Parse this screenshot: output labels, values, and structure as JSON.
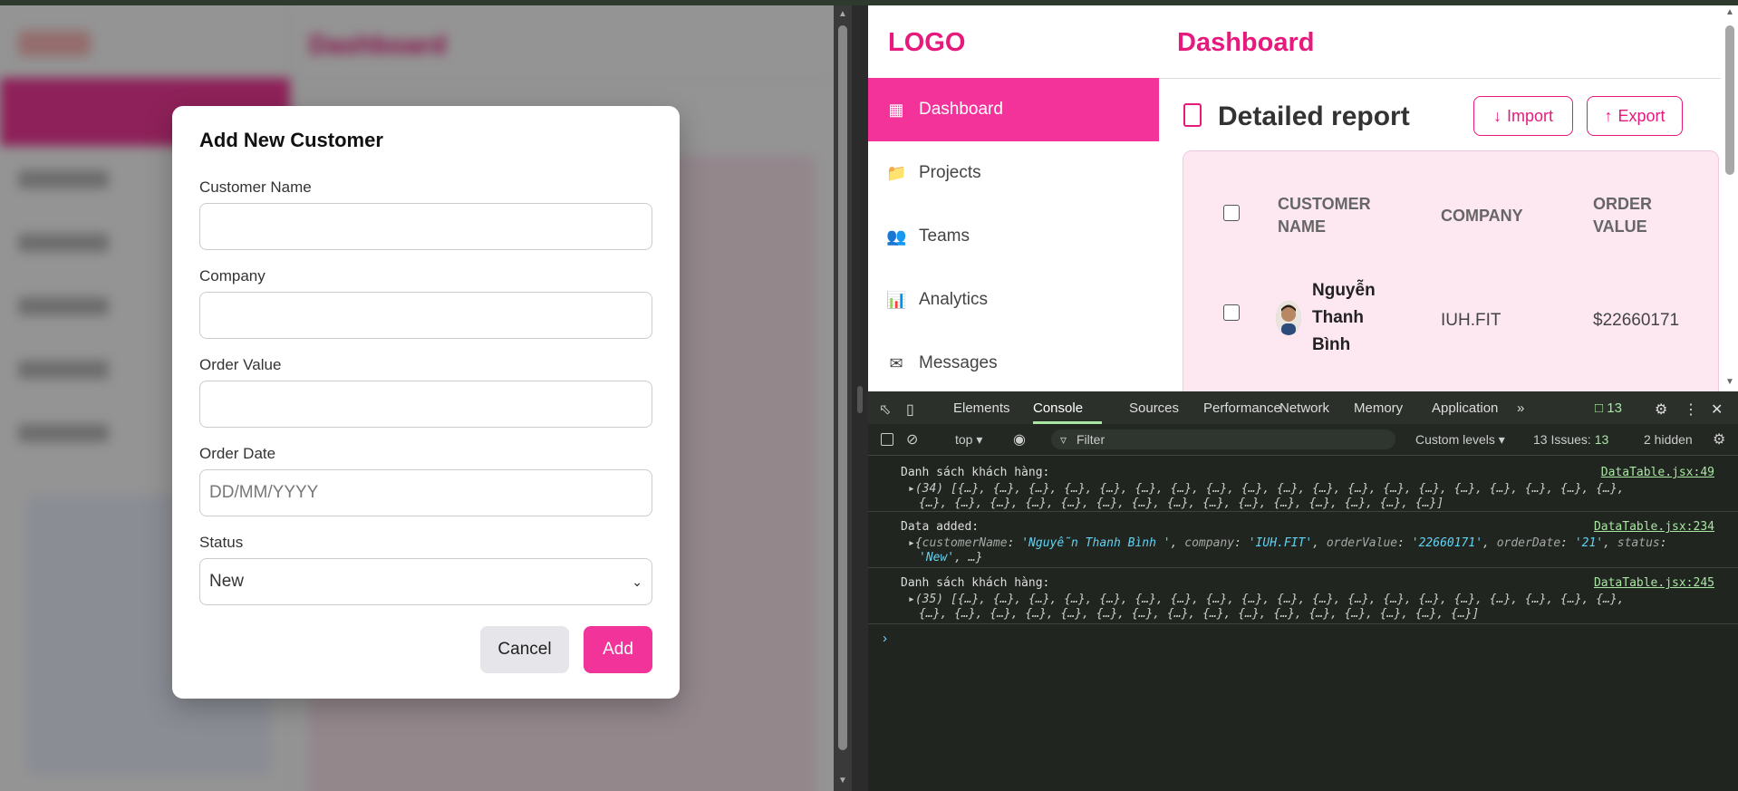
{
  "left": {
    "header_title": "Dashboard",
    "modal": {
      "title": "Add New Customer",
      "fields": [
        {
          "label": "Customer Name",
          "value": ""
        },
        {
          "label": "Company",
          "value": ""
        },
        {
          "label": "Order Value",
          "value": ""
        },
        {
          "label": "Order Date",
          "placeholder": "DD/MM/YYYY"
        },
        {
          "label": "Status",
          "value": "New"
        }
      ],
      "cancel_label": "Cancel",
      "add_label": "Add"
    }
  },
  "right": {
    "logo": "LOGO",
    "header_title": "Dashboard",
    "nav": [
      {
        "label": "Dashboard",
        "icon": "grid-icon"
      },
      {
        "label": "Projects",
        "icon": "folder-icon"
      },
      {
        "label": "Teams",
        "icon": "users-icon"
      },
      {
        "label": "Analytics",
        "icon": "chart-icon"
      },
      {
        "label": "Messages",
        "icon": "envelope-icon"
      }
    ],
    "report_title": "Detailed report",
    "import_label": "Import",
    "export_label": "Export",
    "table": {
      "headers": {
        "customer": "CUSTOMER NAME",
        "company": "COMPANY",
        "order": "ORDER VALUE"
      },
      "rows": [
        {
          "customer": "Nguyễn Thanh Bình",
          "company": "IUH.FIT",
          "order": "$22660171"
        }
      ]
    }
  },
  "devtools": {
    "tabs": [
      "Elements",
      "Console",
      "Sources",
      "Performance",
      "Network",
      "Memory",
      "Application"
    ],
    "active_tab": "Console",
    "issues_badge": "13",
    "context": "top",
    "filter_placeholder": "Filter",
    "levels": "Custom levels",
    "issues_text": "13 Issues:",
    "issues_count": "13",
    "hidden_text": "2 hidden",
    "logs": [
      {
        "msg": "Danh sách khách hàng:",
        "src": "DataTable.jsx:49",
        "line1": "(34) [{…}, {…}, {…}, {…}, {…}, {…}, {…}, {…}, {…}, {…}, {…}, {…}, {…}, {…}, {…}, {…}, {…}, {…}, {…},",
        "line2": "{…}, {…}, {…}, {…}, {…}, {…}, {…}, {…}, {…}, {…}, {…}, {…}, {…}, {…}, {…}]"
      },
      {
        "msg": "Data added:",
        "src": "DataTable.jsx:234"
      },
      {
        "msg": "Danh sách khách hàng:",
        "src": "DataTable.jsx:245",
        "line1": "(35) [{…}, {…}, {…}, {…}, {…}, {…}, {…}, {…}, {…}, {…}, {…}, {…}, {…}, {…}, {…}, {…}, {…}, {…}, {…},",
        "line2": "{…}, {…}, {…}, {…}, {…}, {…}, {…}, {…}, {…}, {…}, {…}, {…}, {…}, {…}, {…}, {…}]"
      }
    ],
    "added_obj": {
      "k1": "customerName",
      "v1": "'Nguyễn Thanh Bình '",
      "k2": "company",
      "v2": "'IUH.FIT'",
      "k3": "orderValue",
      "v3": "'22660171'",
      "k4": "orderDate",
      "v4": "'21'",
      "k5": "status",
      "v5": "'New'",
      "more": ", …}"
    }
  }
}
